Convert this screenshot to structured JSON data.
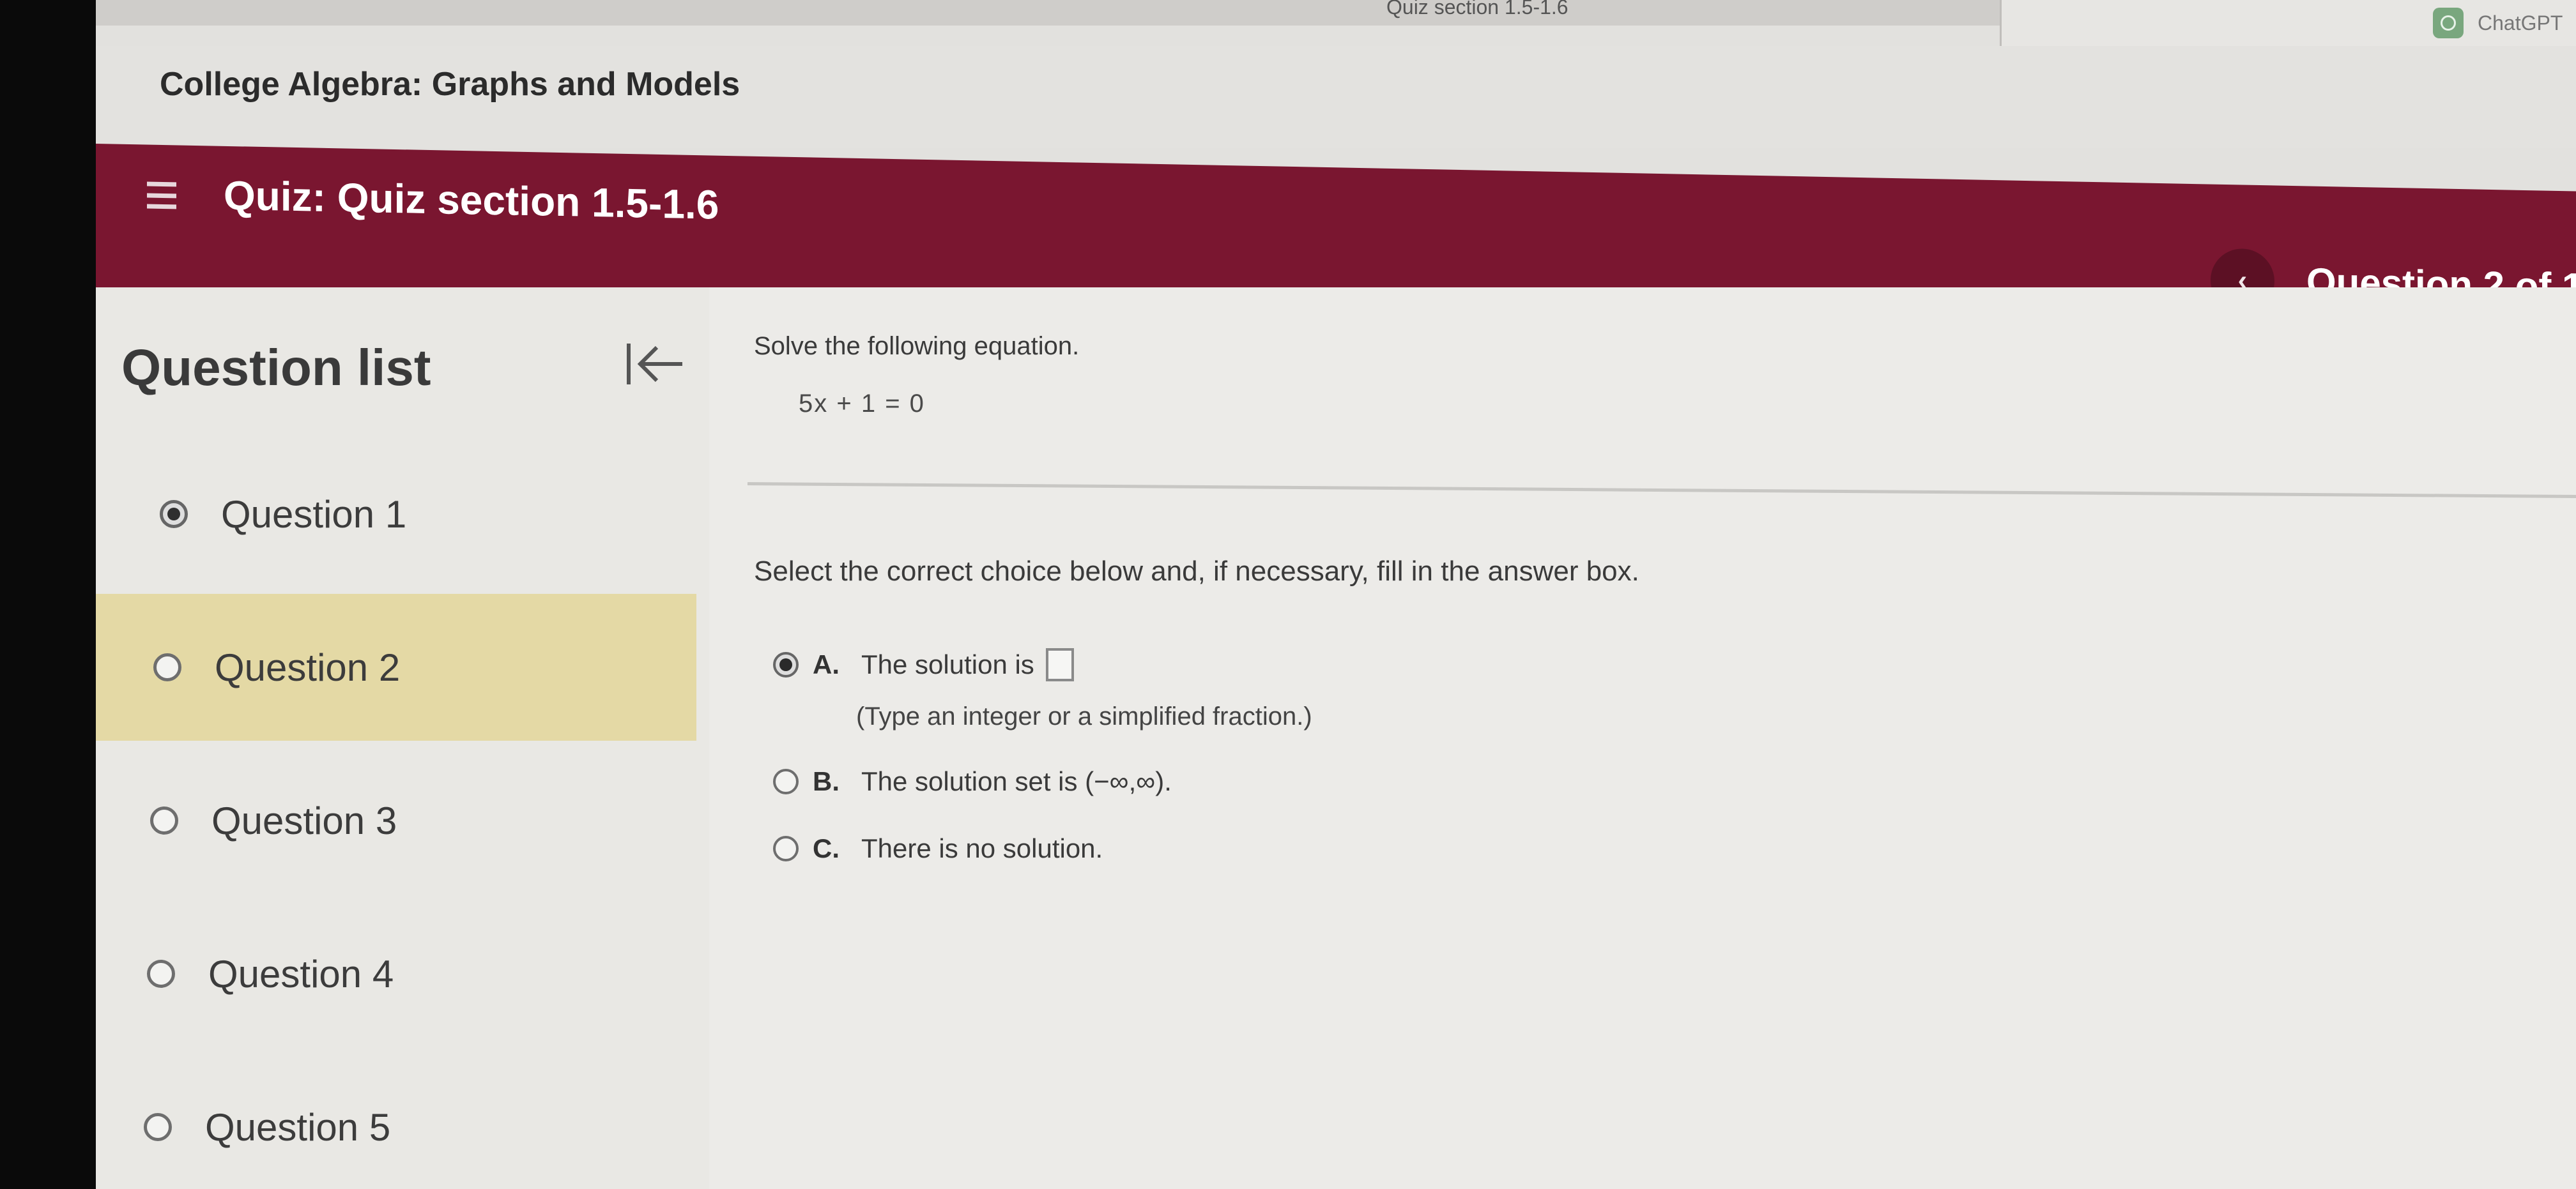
{
  "browser": {
    "tab_center_label": "Quiz section 1.5-1.6",
    "tab_right_label": "ChatGPT"
  },
  "course": {
    "title": "College Algebra: Graphs and Models"
  },
  "quiz": {
    "title": "Quiz: Quiz section 1.5-1.6",
    "prev_symbol": "‹",
    "question_counter": "Question 2 of 1"
  },
  "sidebar": {
    "header": "Question list",
    "items": [
      {
        "label": "Question 1",
        "state": "answered"
      },
      {
        "label": "Question 2",
        "state": "current"
      },
      {
        "label": "Question 3",
        "state": "unanswered"
      },
      {
        "label": "Question 4",
        "state": "unanswered"
      },
      {
        "label": "Question 5",
        "state": "unanswered"
      }
    ]
  },
  "question": {
    "instruction": "Solve the following equation.",
    "equation": "5x + 1 = 0",
    "select_instruction": "Select the correct choice below and, if necessary, fill in the answer box.",
    "choices": [
      {
        "letter": "A.",
        "text": "The solution is",
        "has_answer_box": true,
        "selected": true
      },
      {
        "letter": "B.",
        "text": "The solution set is (−∞,∞).",
        "has_answer_box": false,
        "selected": false
      },
      {
        "letter": "C.",
        "text": "There is no solution.",
        "has_answer_box": false,
        "selected": false
      }
    ],
    "hint": "(Type an integer or a simplified fraction.)"
  },
  "colors": {
    "header_maroon": "#7a1630",
    "active_question_bg": "#e4d9a5"
  },
  "icons": {
    "menu": "hamburger-icon",
    "collapse": "collapse-left-icon",
    "prev": "chevron-left-icon",
    "chat": "chatgpt-icon"
  }
}
